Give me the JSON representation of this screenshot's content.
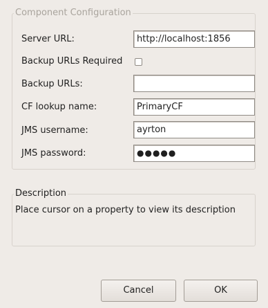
{
  "config_group": {
    "title": "Component Configuration",
    "server_url": {
      "label": "Server URL:",
      "value": "http://localhost:1856"
    },
    "backup_required": {
      "label": "Backup URLs Required",
      "checked": false
    },
    "backup_urls": {
      "label": "Backup URLs:",
      "value": ""
    },
    "cf_lookup": {
      "label": "CF lookup name:",
      "value": "PrimaryCF"
    },
    "jms_username": {
      "label": "JMS username:",
      "value": "ayrton"
    },
    "jms_password": {
      "label": "JMS password:",
      "masked_value": "●●●●●"
    }
  },
  "description_group": {
    "title": "Description",
    "text": "Place cursor on a property to view its description"
  },
  "buttons": {
    "cancel": "Cancel",
    "ok": "OK"
  }
}
